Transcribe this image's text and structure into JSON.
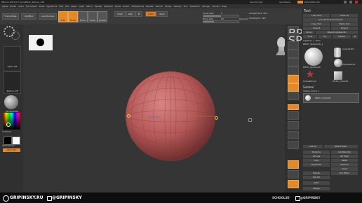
{
  "titlebar": {
    "title": "ZBrush 2021.6.2  DynaMesh_Sphere_128",
    "quicksave": "QuickSave",
    "default_zscript": "DefaultZScript",
    "see_through": "See-through"
  },
  "menu": [
    "Alpha",
    "Brush",
    "Color",
    "Document",
    "Draw",
    "Dynamics",
    "Edit",
    "File",
    "Layer",
    "Light",
    "Macro",
    "Marker",
    "Material",
    "Movie",
    "Picker",
    "Preferences",
    "Render",
    "Stencil",
    "Stroke",
    "Texture",
    "Tool",
    "Transform",
    "Zplugin",
    "Zscript",
    "Help"
  ],
  "toolbar": {
    "home_page": "Home Page",
    "lightbox": "LightBox",
    "live_boolean": "Live Boolean",
    "focal_shift_label": "Focal Shift",
    "focal_shift_value": "0",
    "draw_size_label": "Draw Size",
    "draw_size_value": "64",
    "active_points": "ActivePoints: 563",
    "total_points": "TotalPoints: 563",
    "dynamic": "Dynamic",
    "icon_labels": [
      "Edit",
      "Draw",
      "Move",
      "Scale",
      "Rotate",
      "Mrgb",
      "Rgb",
      "M",
      "Zadd",
      "Zsub"
    ]
  },
  "left_shelf": {
    "alpha_label": "Alpha Off",
    "texture_label": "Texture Off",
    "material_label": "SkinShade4",
    "gradient_label": "Gradient",
    "switch_color": "SwitchColor",
    "alternate": "Alternate"
  },
  "viewport": {
    "shelf_buttons": [
      "BPR",
      "SPix 3",
      "Scroll",
      "Zoom",
      "Actual",
      "AAHalf",
      "Persp",
      "Floor",
      "Local",
      "L.Sym",
      "Frame",
      "Move",
      "Scale",
      "Rotate",
      "PolyF",
      "Transp",
      "Solo",
      "Xpose"
    ]
  },
  "right_tray": {
    "header": "Tool",
    "buttons": [
      "Load Tool",
      "Save As",
      "Load Tools From Project",
      "Copy Tool",
      "Paste Tool",
      "Import",
      "Export",
      "Clone",
      "Make PolyMesh3D",
      "GoZ",
      "All",
      "Visible",
      "R"
    ],
    "lightbox_tools": "Lightbox > Tools",
    "current_tool": "PM3D_Sphere3D_1",
    "thumbs": [
      "PM3D_Sphere3D",
      "Cylinder3D",
      "PolyMesh3D",
      "SimpleBrush",
      "PM3D_Cube3D"
    ],
    "subtool": "Subtool",
    "visible_count": "Visible Count 1",
    "subtool_item": "PM3D_Cube3D",
    "list_all": "List All",
    "auto_collapse": "Auto Collapse",
    "new_folder": "New Folder",
    "bottom": [
      "Rename",
      "AutoReorder",
      "All Low",
      "All High",
      "Copy",
      "Paste",
      "Duplicate",
      "Append",
      "Insert",
      "Delete",
      "Del Other",
      "Del All",
      "Split",
      "Merge"
    ]
  },
  "footer": {
    "left_brand": "GRIPINSKY.RU",
    "left_handle": "@GRIPINSKY",
    "school": "SCHOOL3D",
    "right_handle": "@GRIPINSKY"
  },
  "colors": {
    "accent": "#e08a2c",
    "sphere": "#b85a5a",
    "background": "#353535"
  }
}
